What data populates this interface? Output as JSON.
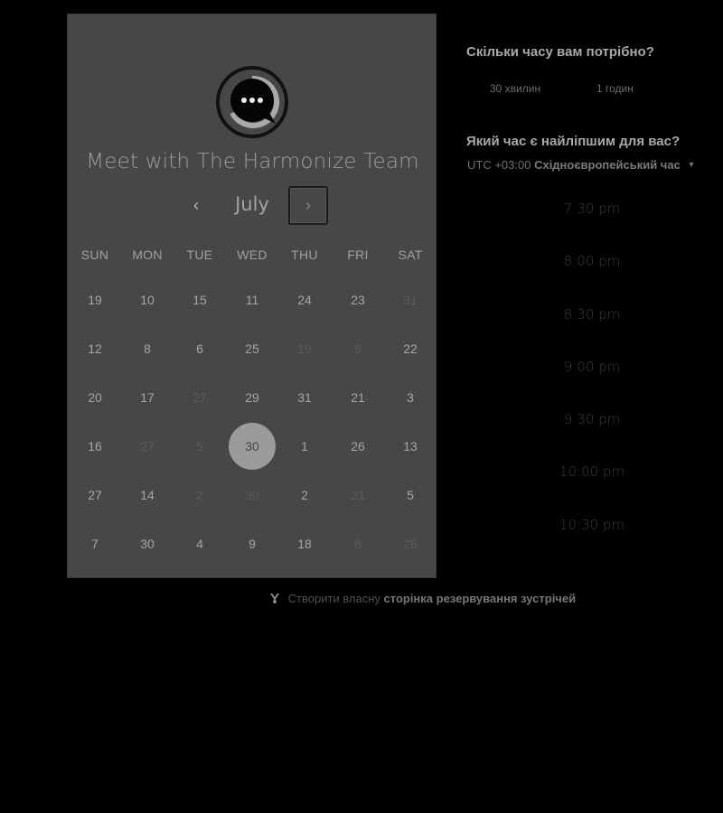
{
  "card": {
    "title": "Meet with The Harmonize Team",
    "month": "July",
    "prev_glyph": "‹",
    "next_glyph": "›",
    "weekdays": [
      "SUN",
      "MON",
      "TUE",
      "WED",
      "THU",
      "FRI",
      "SAT"
    ],
    "weeks": [
      [
        {
          "d": "19",
          "m": false
        },
        {
          "d": "10",
          "m": false
        },
        {
          "d": "15",
          "m": false
        },
        {
          "d": "11",
          "m": false
        },
        {
          "d": "24",
          "m": false
        },
        {
          "d": "23",
          "m": false
        },
        {
          "d": "31",
          "m": true
        }
      ],
      [
        {
          "d": "12",
          "m": false
        },
        {
          "d": "8",
          "m": false
        },
        {
          "d": "6",
          "m": false
        },
        {
          "d": "25",
          "m": false
        },
        {
          "d": "19",
          "m": true
        },
        {
          "d": "9",
          "m": true
        },
        {
          "d": "22",
          "m": false
        }
      ],
      [
        {
          "d": "20",
          "m": false
        },
        {
          "d": "17",
          "m": false
        },
        {
          "d": "27",
          "m": true
        },
        {
          "d": "29",
          "m": false
        },
        {
          "d": "31",
          "m": false
        },
        {
          "d": "21",
          "m": false
        },
        {
          "d": "3",
          "m": false
        }
      ],
      [
        {
          "d": "16",
          "m": false
        },
        {
          "d": "27",
          "m": true
        },
        {
          "d": "5",
          "m": true
        },
        {
          "d": "30",
          "m": false,
          "selected": true
        },
        {
          "d": "1",
          "m": false
        },
        {
          "d": "26",
          "m": false
        },
        {
          "d": "13",
          "m": false
        }
      ],
      [
        {
          "d": "27",
          "m": false
        },
        {
          "d": "14",
          "m": false
        },
        {
          "d": "2",
          "m": true
        },
        {
          "d": "30",
          "m": true
        },
        {
          "d": "2",
          "m": false
        },
        {
          "d": "21",
          "m": true
        },
        {
          "d": "5",
          "m": false
        }
      ],
      [
        {
          "d": "7",
          "m": false
        },
        {
          "d": "30",
          "m": false
        },
        {
          "d": "4",
          "m": false
        },
        {
          "d": "9",
          "m": false
        },
        {
          "d": "18",
          "m": false
        },
        {
          "d": "6",
          "m": true
        },
        {
          "d": "28",
          "m": true
        }
      ]
    ]
  },
  "durations": {
    "question": "Скільки часу вам потрібно?",
    "options": [
      "30 хвилин",
      "1 годин"
    ]
  },
  "times": {
    "question": "Який час є найліпшим для вас?",
    "tz_offset": "UTC +03:00",
    "tz_name": "Східноєвропейський час",
    "tz_caret": "▼",
    "slots": [
      "7:30 pm",
      "8:00 pm",
      "8:30 pm",
      "9:00 pm",
      "9:30 pm",
      "10:00 pm",
      "10:30 pm"
    ]
  },
  "footer": {
    "prefix": "Створити власну",
    "link": "сторінка резервування зустрічей"
  },
  "colors": {
    "card_bg": "#474747",
    "selected_day_bg": "#9b9b9b",
    "page_bg": "#000000"
  }
}
